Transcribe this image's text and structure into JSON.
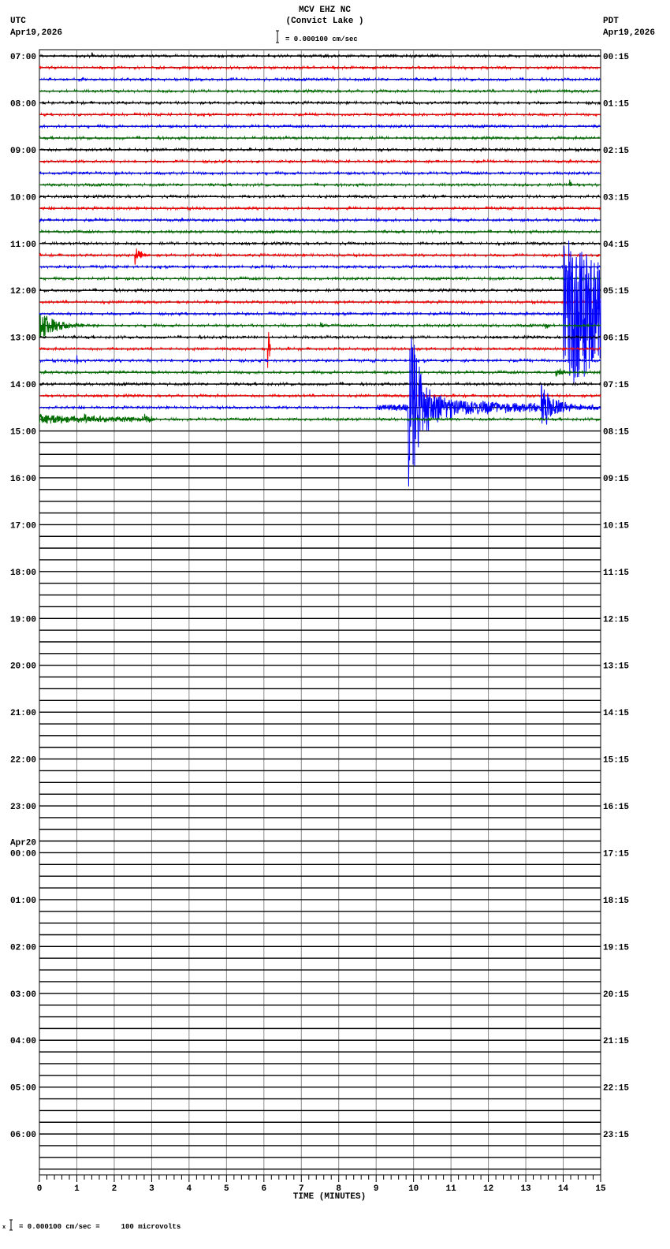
{
  "header": {
    "title": "MCV EHZ NC",
    "subtitle": "(Convict Lake )",
    "scale_label": "= 0.000100 cm/sec",
    "left_zone": "UTC",
    "left_date": "Apr19,2026",
    "right_zone": "PDT",
    "right_date": "Apr19,2026"
  },
  "footer": {
    "mark": "x",
    "scale_text": "= 0.000100 cm/sec =     100 microvolts"
  },
  "chart_data": {
    "type": "line",
    "title": "MCV EHZ NC (Convict Lake )",
    "xlabel": "TIME (MINUTES)",
    "xlim": [
      0,
      15
    ],
    "x_ticks": [
      "0",
      "1",
      "2",
      "3",
      "4",
      "5",
      "6",
      "7",
      "8",
      "9",
      "10",
      "11",
      "12",
      "13",
      "14",
      "15"
    ],
    "rows_per_hour": 4,
    "total_rows": 96,
    "rows_with_data": 32,
    "color_cycle": [
      "#000000",
      "#ff0000",
      "#0000ff",
      "#007000"
    ],
    "left_labels": [
      {
        "row": 0,
        "text": "07:00"
      },
      {
        "row": 4,
        "text": "08:00"
      },
      {
        "row": 8,
        "text": "09:00"
      },
      {
        "row": 12,
        "text": "10:00"
      },
      {
        "row": 16,
        "text": "11:00"
      },
      {
        "row": 20,
        "text": "12:00"
      },
      {
        "row": 24,
        "text": "13:00"
      },
      {
        "row": 28,
        "text": "14:00"
      },
      {
        "row": 32,
        "text": "15:00"
      },
      {
        "row": 36,
        "text": "16:00"
      },
      {
        "row": 40,
        "text": "17:00"
      },
      {
        "row": 44,
        "text": "18:00"
      },
      {
        "row": 48,
        "text": "19:00"
      },
      {
        "row": 52,
        "text": "20:00"
      },
      {
        "row": 56,
        "text": "21:00"
      },
      {
        "row": 60,
        "text": "22:00"
      },
      {
        "row": 64,
        "text": "23:00"
      },
      {
        "row": 68,
        "text": "00:00",
        "date": "Apr20"
      },
      {
        "row": 72,
        "text": "01:00"
      },
      {
        "row": 76,
        "text": "02:00"
      },
      {
        "row": 80,
        "text": "03:00"
      },
      {
        "row": 84,
        "text": "04:00"
      },
      {
        "row": 88,
        "text": "05:00"
      },
      {
        "row": 92,
        "text": "06:00"
      }
    ],
    "right_labels": [
      "00:15",
      "01:15",
      "02:15",
      "03:15",
      "04:15",
      "05:15",
      "06:15",
      "07:15",
      "08:15",
      "09:15",
      "10:15",
      "11:15",
      "12:15",
      "13:15",
      "14:15",
      "15:15",
      "16:15",
      "17:15",
      "18:15",
      "19:15",
      "20:15",
      "21:15",
      "22:15",
      "23:15"
    ],
    "events": [
      {
        "row": 0,
        "start": 1.4,
        "amp": 0.6,
        "decay": 0.03,
        "dur": 0.1
      },
      {
        "row": 0,
        "start": 2.5,
        "amp": 0.2,
        "decay": 0.05,
        "dur": 0.05
      },
      {
        "row": 11,
        "start": 14.15,
        "amp": 0.9,
        "decay": 0.05,
        "dur": 0.15
      },
      {
        "row": 17,
        "start": 2.55,
        "amp": 0.8,
        "decay": 0.15,
        "dur": 0.4
      },
      {
        "row": 22,
        "start": 14.0,
        "amp": 6.5,
        "decay": 3,
        "dur": 1.0
      },
      {
        "row": 23,
        "start": 0,
        "amp": 1.3,
        "decay": 0.45,
        "dur": 1.8
      },
      {
        "row": 23,
        "start": 7.5,
        "amp": 0.3,
        "decay": 0.1,
        "dur": 0.3
      },
      {
        "row": 23,
        "start": 13.5,
        "amp": 0.4,
        "decay": 0.1,
        "dur": 0.3
      },
      {
        "row": 25,
        "start": 6.1,
        "amp": 4,
        "decay": 0.03,
        "dur": 0.08
      },
      {
        "row": 26,
        "start": 1.0,
        "amp": 0.6,
        "decay": 0.02,
        "dur": 0.05
      },
      {
        "row": 27,
        "start": 13.8,
        "amp": 0.4,
        "decay": 0.2,
        "dur": 0.4
      },
      {
        "row": 30,
        "start": 9.0,
        "amp": 0.25,
        "decay": 10,
        "dur": 0.85
      },
      {
        "row": 30,
        "start": 9.85,
        "amp": 8,
        "decay": 0.35,
        "dur": 5.15
      },
      {
        "row": 30,
        "start": 9.85,
        "amp": 1.0,
        "decay": 3,
        "dur": 5.15
      },
      {
        "row": 30,
        "start": 13.4,
        "amp": 2.5,
        "decay": 0.3,
        "dur": 1.0
      },
      {
        "row": 31,
        "start": 0,
        "amp": 0.4,
        "decay": 3,
        "dur": 3
      },
      {
        "row": 31,
        "start": 1.2,
        "amp": 0.5,
        "decay": 0.05,
        "dur": 0.1
      },
      {
        "row": 31,
        "start": 2.8,
        "amp": 0.6,
        "decay": 0.15,
        "dur": 0.3
      }
    ]
  }
}
